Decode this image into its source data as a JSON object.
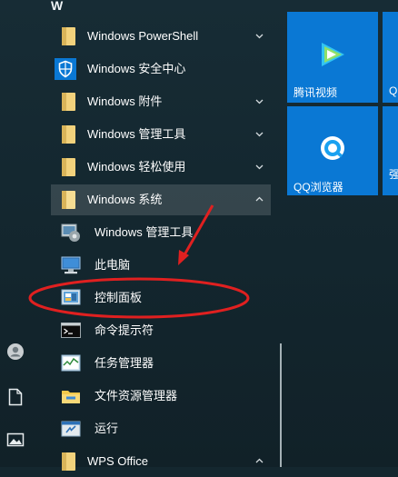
{
  "start_menu": {
    "letter_header": "W",
    "apps": [
      {
        "label": "Windows PowerShell",
        "icon": "folder-icon",
        "chevron": "down"
      },
      {
        "label": "Windows 安全中心",
        "icon": "shield-icon"
      },
      {
        "label": "Windows 附件",
        "icon": "folder-icon",
        "chevron": "down"
      },
      {
        "label": "Windows 管理工具",
        "icon": "folder-icon",
        "chevron": "down"
      },
      {
        "label": "Windows 轻松使用",
        "icon": "folder-icon",
        "chevron": "down"
      },
      {
        "label": "Windows 系统",
        "icon": "folder-open-icon",
        "chevron": "up"
      }
    ],
    "system_items": [
      {
        "label": "Windows 管理工具",
        "icon": "admin-tools-icon"
      },
      {
        "label": "此电脑",
        "icon": "computer-icon"
      },
      {
        "label": "控制面板",
        "icon": "control-panel-icon"
      },
      {
        "label": "命令提示符",
        "icon": "command-prompt-icon"
      },
      {
        "label": "任务管理器",
        "icon": "task-manager-icon"
      },
      {
        "label": "文件资源管理器",
        "icon": "file-explorer-icon"
      },
      {
        "label": "运行",
        "icon": "run-icon"
      }
    ],
    "last_app": {
      "label": "WPS Office",
      "icon": "folder-icon",
      "chevron": "up"
    }
  },
  "left_rail": [
    {
      "icon": "user-icon"
    },
    {
      "icon": "document-icon"
    },
    {
      "icon": "pictures-icon"
    }
  ],
  "tiles": [
    {
      "label": "腾讯视频",
      "icon": "tencent-video-icon"
    },
    {
      "label": "Q",
      "icon": ""
    },
    {
      "label": "QQ浏览器",
      "icon": "qq-browser-icon"
    },
    {
      "label": "强",
      "icon": ""
    }
  ],
  "colors": {
    "background": "#14272f",
    "tile": "#0a78d4",
    "folder": "#f2d27c",
    "annotation": "#e02020"
  }
}
